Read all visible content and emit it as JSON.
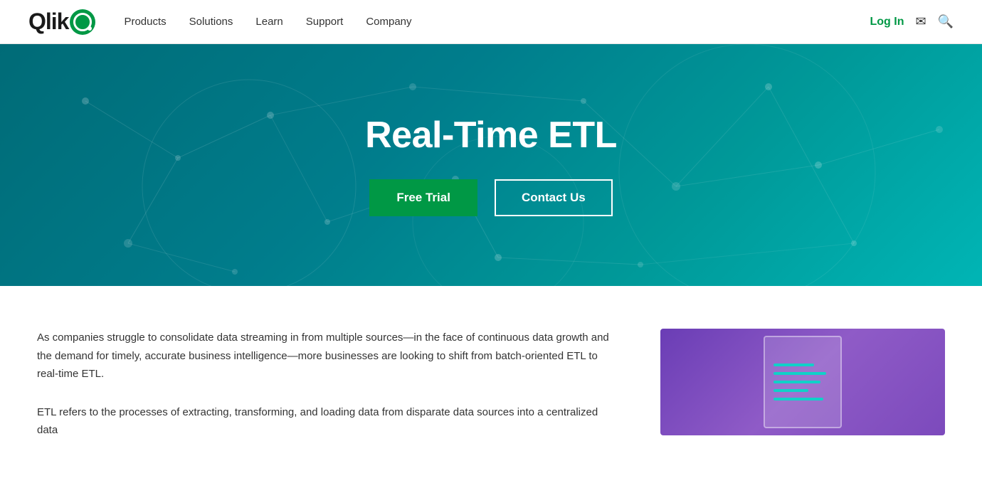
{
  "brand": {
    "name": "Qlik",
    "logo_text": "Qlik"
  },
  "navbar": {
    "links": [
      {
        "label": "Products",
        "id": "products"
      },
      {
        "label": "Solutions",
        "id": "solutions"
      },
      {
        "label": "Learn",
        "id": "learn"
      },
      {
        "label": "Support",
        "id": "support"
      },
      {
        "label": "Company",
        "id": "company"
      }
    ],
    "login_label": "Log In"
  },
  "hero": {
    "title": "Real-Time ETL",
    "free_trial_label": "Free Trial",
    "contact_label": "Contact Us"
  },
  "content": {
    "paragraph1": "As companies struggle to consolidate data streaming in from multiple sources—in the face of continuous data growth and the demand for timely, accurate business intelligence—more businesses are looking to shift from batch-oriented ETL to real-time ETL.",
    "paragraph2": "ETL refers to the processes of extracting, transforming, and loading data from disparate data sources into a centralized data"
  }
}
